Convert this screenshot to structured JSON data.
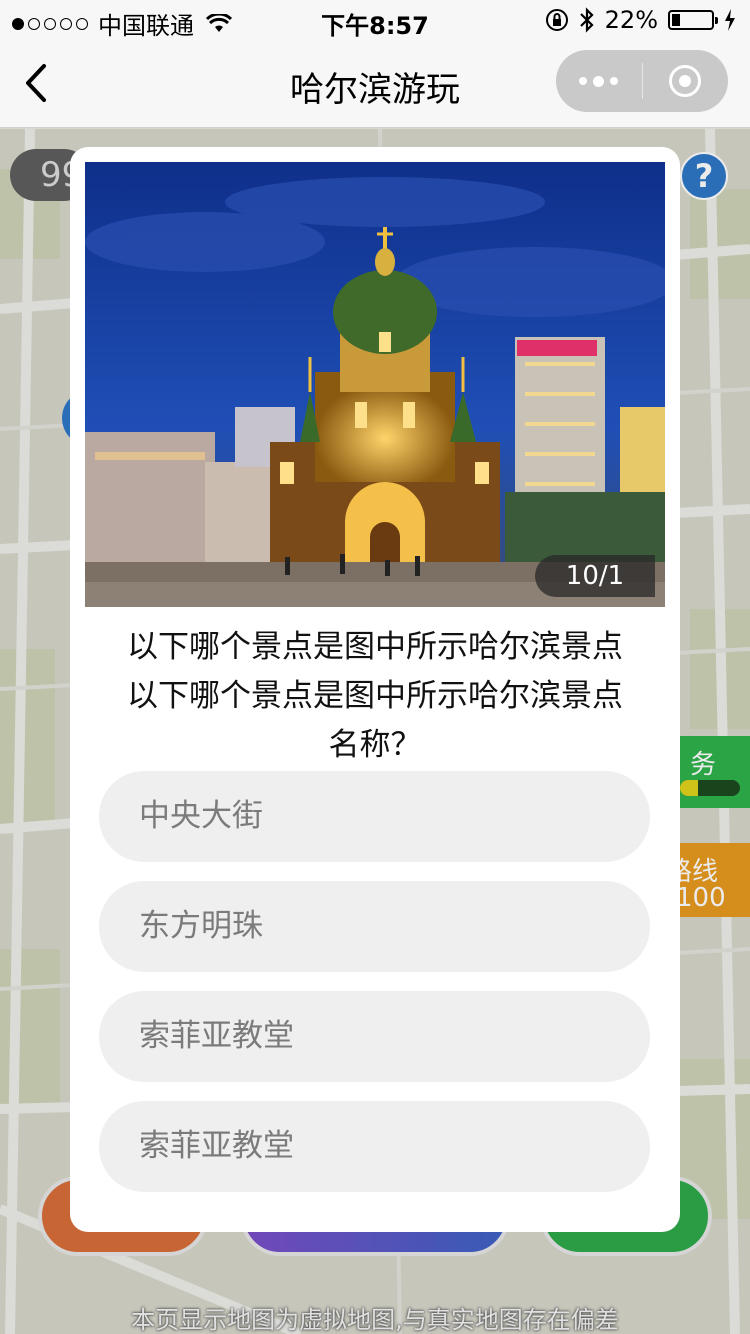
{
  "status_bar": {
    "carrier": "中国联通",
    "time": "下午8:57",
    "battery": "22%"
  },
  "nav": {
    "title": "哈尔滨游玩"
  },
  "map": {
    "score": "99",
    "help_label": "?",
    "task_label": "务",
    "route_label": "路线",
    "route_value": "100",
    "note": "本页显示地图为虚拟地图,与真实地图存在偏差"
  },
  "quiz": {
    "counter": "10/1",
    "question_line1": "以下哪个景点是图中所示哈尔滨景点",
    "question_line2": "以下哪个景点是图中所示哈尔滨景点",
    "question_line3": "名称？",
    "options": [
      {
        "label": "中央大街"
      },
      {
        "label": "东方明珠"
      },
      {
        "label": "索菲亚教堂"
      },
      {
        "label": "索菲亚教堂"
      }
    ]
  },
  "colors": {
    "accent_blue": "#2f78c8",
    "task_green": "#2eb24a",
    "route_orange": "#e89a1e",
    "option_bg": "#efefef",
    "option_text": "#7b7b7b"
  },
  "icons": [
    "back-icon",
    "wifi-icon",
    "lock-rotation-icon",
    "bluetooth-icon",
    "battery-icon",
    "more-icon",
    "close-mini-program-icon",
    "help-icon"
  ]
}
